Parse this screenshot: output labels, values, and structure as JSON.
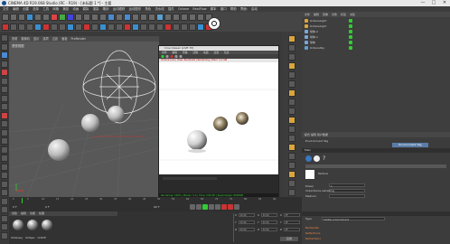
{
  "window": {
    "title": "CINEMA 4D R19.068 Studio (RC - R19) - [未标题 1 *] - 主要",
    "minimize": "—",
    "maximize": "□",
    "close": "✕"
  },
  "menubar": {
    "items": [
      "文件",
      "编辑",
      "创建",
      "选择",
      "工具",
      "网格",
      "捕捉",
      "动画",
      "模拟",
      "渲染",
      "雕刻",
      "运动跟踪",
      "运动图形",
      "角色",
      "流水线",
      "插件",
      "Octane",
      "RealFlow",
      "脚本",
      "窗口",
      "帮助",
      "界面:",
      "启动"
    ]
  },
  "viewport": {
    "header_items": [
      "查看",
      "摄像机",
      "显示",
      "选项",
      "过滤",
      "面板",
      "ProRender"
    ],
    "label": "透视视图"
  },
  "render_window": {
    "title": "Cine Viewer (LIVE 78)",
    "menu": [
      "文件",
      "编辑",
      "查看",
      "比较",
      "动画",
      "过滤",
      "信息"
    ],
    "info": "Octane Live | View: Rendered | Rendering | Mem: 2.2 GB",
    "status": "Rendering: 100% | Ms/sec: 5.2 | Time: 0:00:00 | Spp/maxspp: 800/800"
  },
  "object_manager": {
    "menu": [
      "文件",
      "编辑",
      "查看",
      "对象",
      "标签",
      "书签"
    ],
    "objects": [
      {
        "name": "OctaneLight",
        "color": "#d9a53c"
      },
      {
        "name": "OctaneLight",
        "color": "#d9a53c"
      },
      {
        "name": "球体.2",
        "color": "#7aa7d9"
      },
      {
        "name": "球体.1",
        "color": "#7aa7d9"
      },
      {
        "name": "球体",
        "color": "#7aa7d9"
      },
      {
        "name": "OctaneSky",
        "color": "#5fa0d0"
      }
    ]
  },
  "attribute_manager": {
    "header": "模式  编辑  用户数据",
    "tag_title": "Environment Tag",
    "tab": "Environment Tag",
    "section": "Main",
    "type_label": "Type",
    "type_value": "Visible environment",
    "texture_label": "Texture",
    "power_label": "Power",
    "power_value": "1",
    "importance_label": "Importance sampling",
    "medium_label": "Medium",
    "visible_bg_label": "Backplate",
    "visible_refl": "Reflections",
    "visible_refr": "Refractions"
  },
  "timeline": {
    "frame_start": "0 F",
    "frame_end": "90 F",
    "current": "0 F",
    "ticks": [
      "0",
      "5",
      "10",
      "15",
      "20",
      "25",
      "30",
      "35",
      "40",
      "45",
      "50",
      "55",
      "60",
      "65",
      "70",
      "75",
      "80",
      "85",
      "90"
    ]
  },
  "material_manager": {
    "menu": [
      "创建",
      "编辑",
      "功能",
      "纹理"
    ],
    "materials": [
      "OctGlossy",
      "OctSpec",
      "OctDiff"
    ]
  },
  "coordinates": {
    "labels": [
      "X",
      "Y",
      "Z"
    ],
    "pos": [
      "0 cm",
      "0 cm",
      "0 cm"
    ],
    "size": [
      "0 cm",
      "0 cm",
      "0 cm"
    ],
    "rot": [
      "0°",
      "0°",
      "0°"
    ],
    "apply": "应用"
  }
}
